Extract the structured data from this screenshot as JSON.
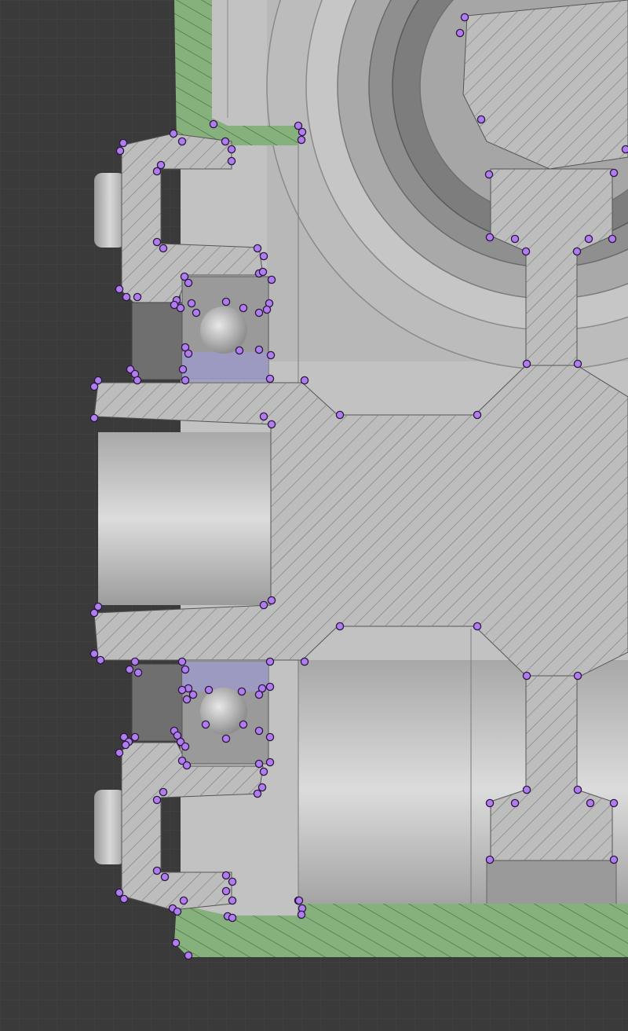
{
  "app": {
    "view": "cad-section-viewport"
  },
  "colors": {
    "background": "#3a3a3a",
    "grid": "#4c4c4c",
    "part_fill": "#bdbdbd",
    "hatch": "#6e6e6e",
    "green_section": "#86b07c",
    "bearing_blue": "#9d9ac8",
    "marker": "#b07cf0"
  },
  "icons": {
    "vertex_marker": "vertex-dot-icon"
  },
  "markers": {
    "count_visible": "many",
    "style": "circle"
  }
}
